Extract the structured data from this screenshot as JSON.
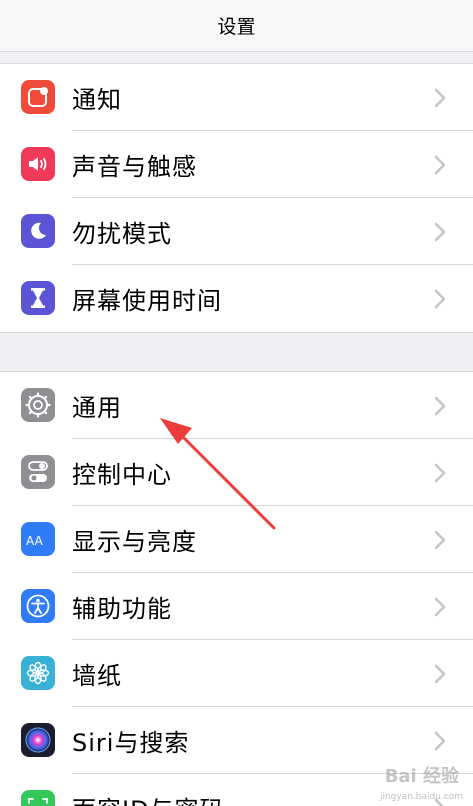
{
  "navbar": {
    "title": "设置"
  },
  "group1": [
    {
      "label": "通知",
      "icon": "notifications-icon",
      "color": "#f04a3a"
    },
    {
      "label": "声音与触感",
      "icon": "speaker-icon",
      "color": "#f03a5a"
    },
    {
      "label": "勿扰模式",
      "icon": "moon-icon",
      "color": "#5b55d6"
    },
    {
      "label": "屏幕使用时间",
      "icon": "hourglass-icon",
      "color": "#5b55d6"
    }
  ],
  "group2": [
    {
      "label": "通用",
      "icon": "gear-icon",
      "color": "#8e8e93"
    },
    {
      "label": "控制中心",
      "icon": "toggle-icon",
      "color": "#8e8e93"
    },
    {
      "label": "显示与亮度",
      "icon": "text-size-icon",
      "color": "#2f7cf6"
    },
    {
      "label": "辅助功能",
      "icon": "accessibility-icon",
      "color": "#2f7cf6"
    },
    {
      "label": "墙纸",
      "icon": "wallpaper-flower-icon",
      "color": "#39b1d6"
    },
    {
      "label": "Siri与搜索",
      "icon": "siri-icon",
      "color": "#1c1c2e"
    },
    {
      "label": "面容ID与密码",
      "icon": "face-id-icon",
      "color": "#34c759"
    }
  ],
  "watermark": {
    "text": "Bai 经验",
    "sub": "jingyan.baidu.com"
  }
}
